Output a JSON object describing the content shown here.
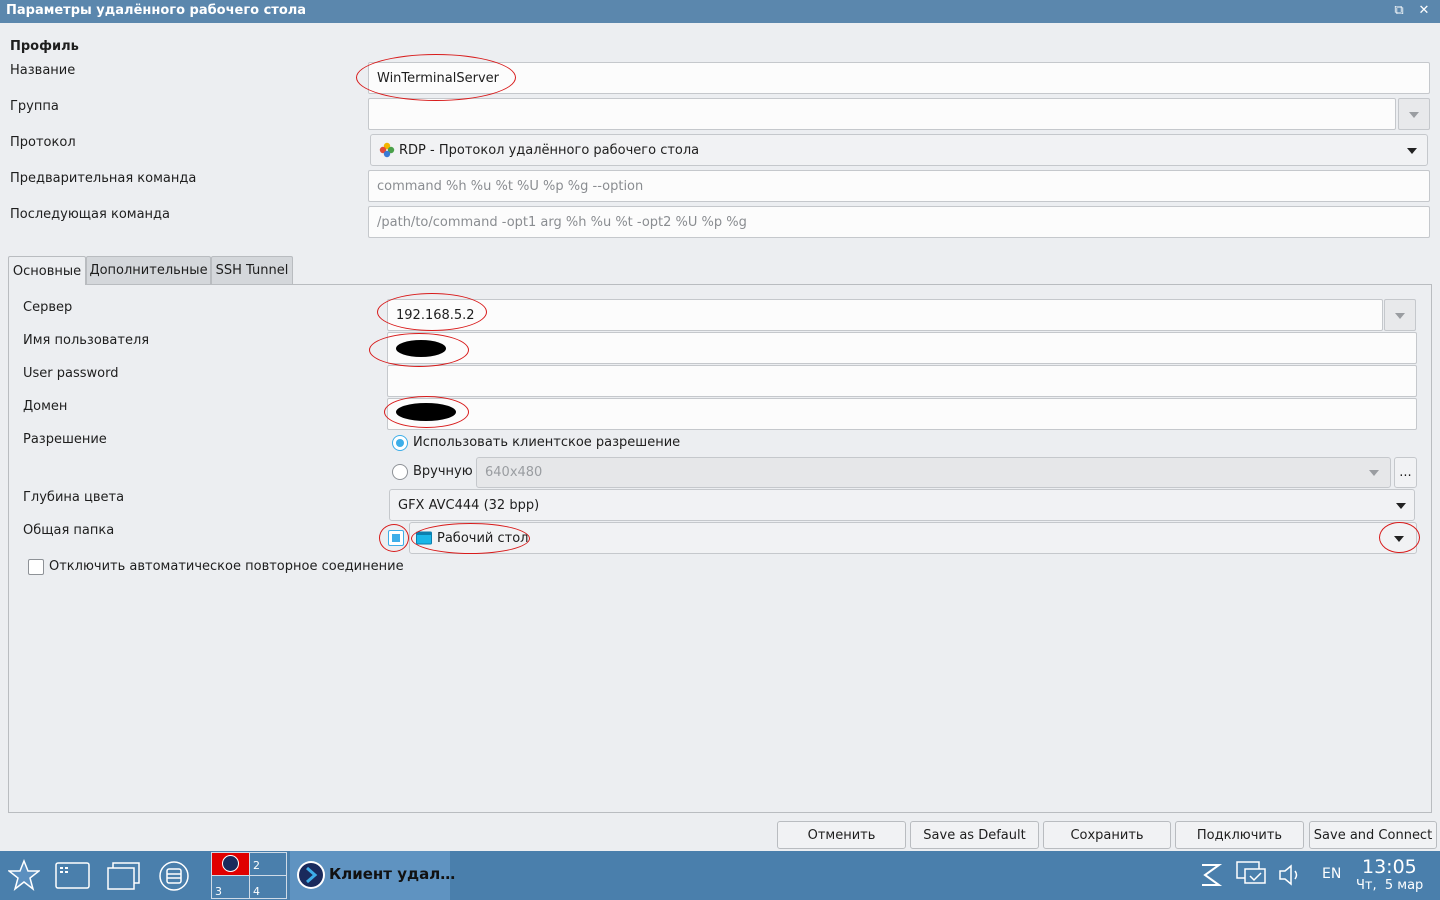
{
  "window": {
    "title": "Параметры удалённого рабочего стола",
    "buttons": [
      "restore-icon",
      "close-icon"
    ]
  },
  "profile": {
    "section_label": "Профиль",
    "name_label": "Название",
    "name_value": "WinTerminalServer",
    "group_label": "Группа",
    "group_value": "",
    "protocol_label": "Протокол",
    "protocol_value": "RDP - Протокол удалённого рабочего стола",
    "precommand_label": "Предварительная команда",
    "precommand_placeholder": "command %h %u %t %U %p %g --option",
    "postcommand_label": "Последующая команда",
    "postcommand_placeholder": "/path/to/command -opt1 arg %h %u %t -opt2 %U %p %g"
  },
  "tabs": [
    {
      "label": "Основные",
      "active": true
    },
    {
      "label": "Дополнительные",
      "active": false
    },
    {
      "label": "SSH Tunnel",
      "active": false
    }
  ],
  "basic": {
    "server_label": "Сервер",
    "server_value": "192.168.5.2",
    "username_label": "Имя пользователя",
    "password_label": "User password",
    "domain_label": "Домен",
    "resolution_label": "Разрешение",
    "resolution_client": "Использовать клиентское разрешение",
    "resolution_manual": "Вручную",
    "resolution_manual_value": "640x480",
    "resolution_more": "...",
    "color_depth_label": "Глубина цвета",
    "color_depth_value": "GFX AVC444 (32 bpp)",
    "shared_folder_label": "Общая папка",
    "shared_folder_value": "Рабочий стол",
    "shared_folder_enabled": true,
    "disable_reconnect_label": "Отключить автоматическое повторное соединение",
    "disable_reconnect_checked": false
  },
  "buttons": {
    "cancel": "Отменить",
    "save_default": "Save as Default",
    "save": "Сохранить",
    "connect": "Подключить",
    "save_connect": "Save and Connect"
  },
  "taskbar": {
    "workspaces": [
      "2",
      "3",
      "4"
    ],
    "task_title": "Клиент удал…",
    "lang": "EN",
    "time": "13:05",
    "date": "Чт,  5 мар"
  },
  "colors": {
    "accent": "#3daee9",
    "titlebar": "#5b87ad",
    "taskbar": "#4a7fac",
    "annotation": "#d81b1b"
  }
}
